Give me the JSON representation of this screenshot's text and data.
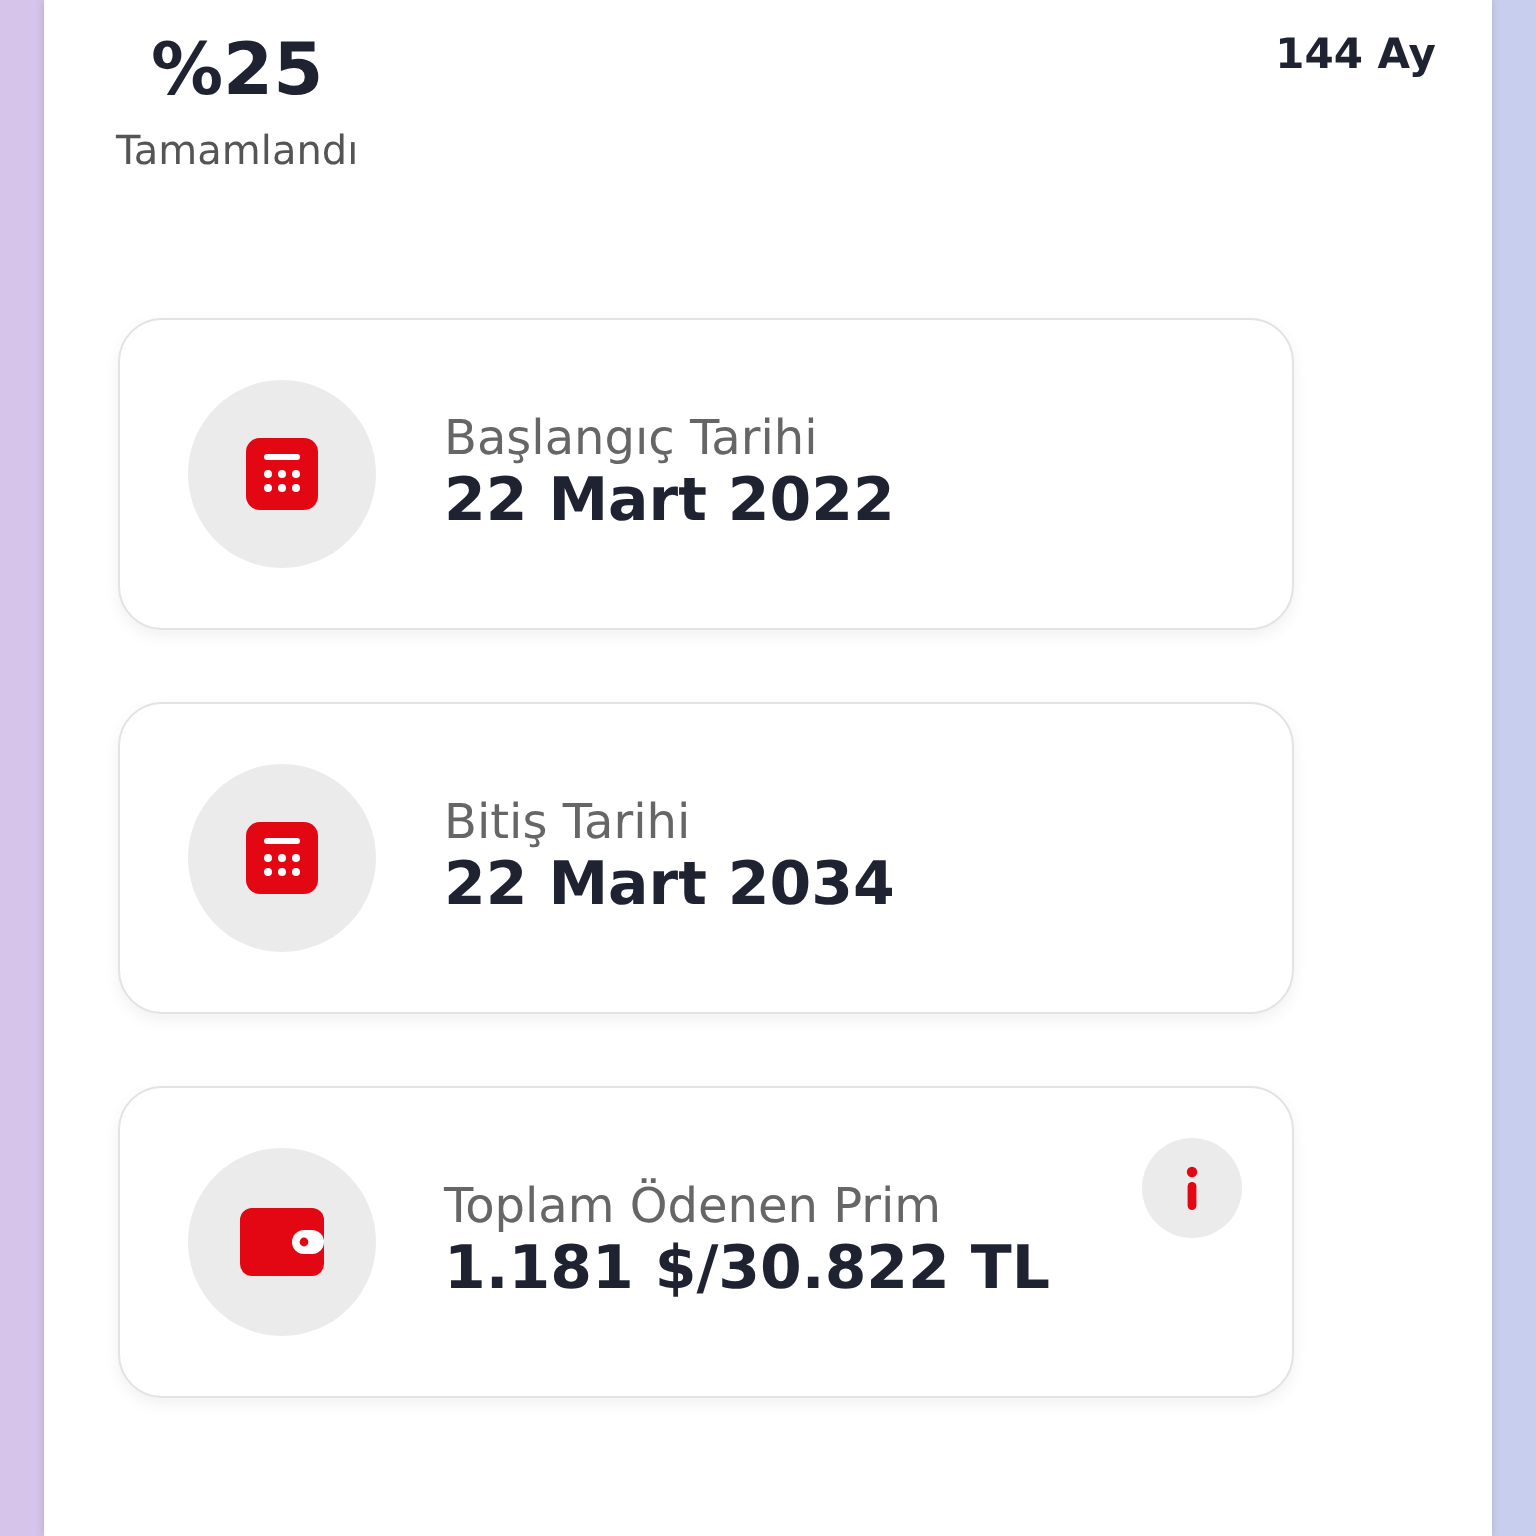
{
  "progress": {
    "percent": "%25",
    "label": "Tamamlandı",
    "duration": "144 Ay"
  },
  "cards": [
    {
      "kind": "calendar",
      "title": "Başlangıç Tarihi",
      "value": "22 Mart 2022",
      "info": false
    },
    {
      "kind": "calendar",
      "title": "Bitiş Tarihi",
      "value": "22 Mart 2034",
      "info": false
    },
    {
      "kind": "wallet",
      "title": "Toplam Ödenen Prim",
      "value": "1.181 $/30.822 TL",
      "info": true
    }
  ]
}
